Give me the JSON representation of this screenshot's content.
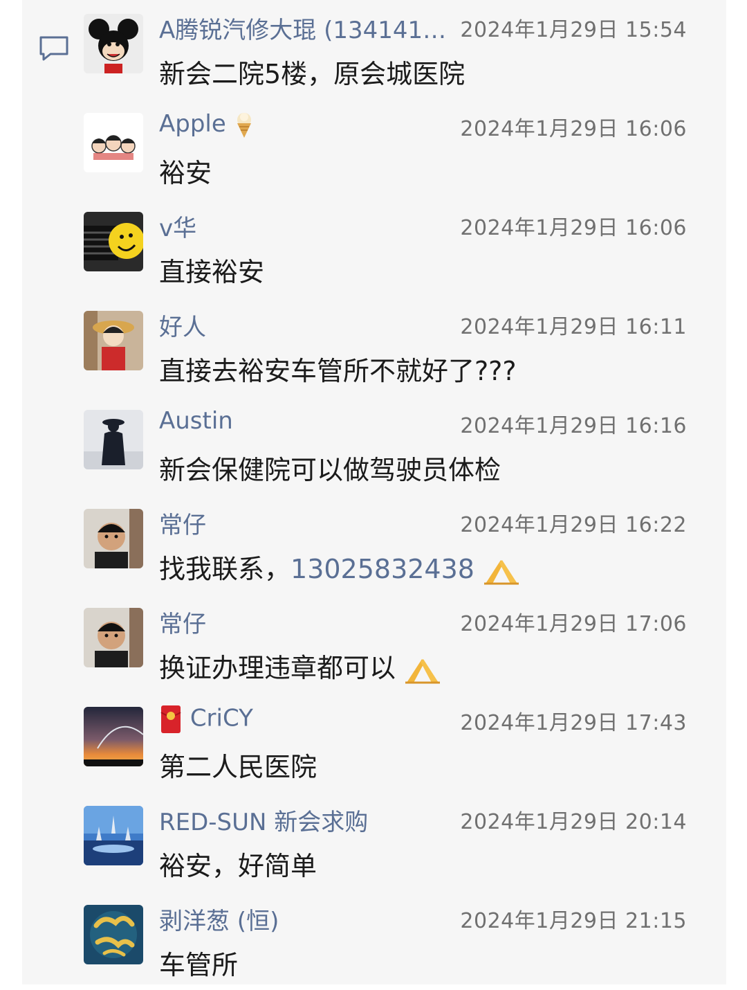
{
  "messages": [
    {
      "sender": "A腾锐汽修大琨 (1341415...",
      "time": "2024年1月29日 15:54",
      "text": "新会二院5楼，原会城医院"
    },
    {
      "sender": "Apple",
      "time": "2024年1月29日 16:06",
      "text": "裕安"
    },
    {
      "sender": "v华",
      "time": "2024年1月29日 16:06",
      "text": "直接裕安"
    },
    {
      "sender": "好人",
      "time": "2024年1月29日 16:11",
      "text": "直接去裕安车管所不就好了???"
    },
    {
      "sender": "Austin",
      "time": "2024年1月29日 16:16",
      "text": "新会保健院可以做驾驶员体检"
    },
    {
      "sender": "常仔",
      "time": "2024年1月29日 16:22",
      "text": "找我联系，",
      "phone": "13025832438"
    },
    {
      "sender": "常仔",
      "time": "2024年1月29日 17:06",
      "text": "换证办理违章都可以"
    },
    {
      "sender": "CriCY",
      "time": "2024年1月29日 17:43",
      "text": "第二人民医院"
    },
    {
      "sender": "RED-SUN 新会求购",
      "time": "2024年1月29日 20:14",
      "text": "裕安，好简单"
    },
    {
      "sender": "剥洋葱 (恒)",
      "time": "2024年1月29日 21:15",
      "text": "车管所"
    }
  ],
  "colors": {
    "panel_bg": "#f6f6f6",
    "name": "#5a6f94",
    "time": "#707070",
    "text": "#1b1b1b"
  },
  "icons": {
    "comment": "comment-icon",
    "ice_cream": "ice-cream-emoji",
    "red_envelope": "red-envelope-emoji",
    "pray": "pray-emoji"
  }
}
